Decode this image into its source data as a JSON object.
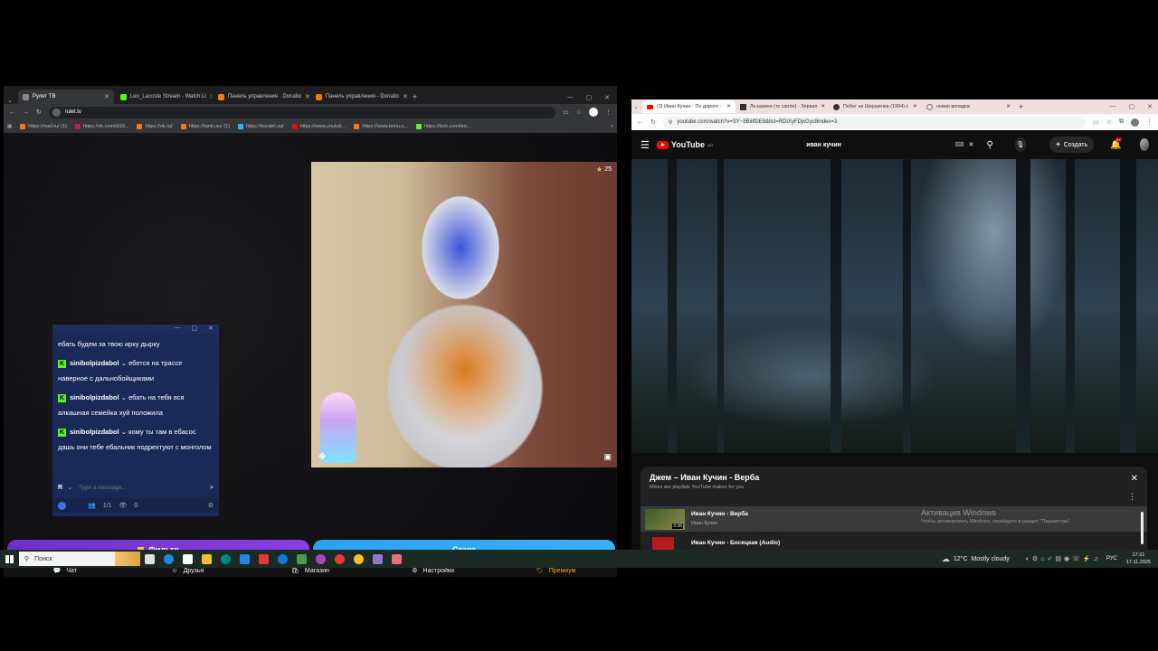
{
  "left_browser": {
    "tabs": [
      {
        "title": "Рулет ТВ",
        "active": true,
        "color": "#888888"
      },
      {
        "title": "Leo_Lacoste Stream - Watch Li",
        "color": "#53fc18"
      },
      {
        "title": "Панель управления - Donatio",
        "color": "#f57c00"
      },
      {
        "title": "Панель управления - Donatio",
        "color": "#f57c00"
      }
    ],
    "url": "rulet.tv",
    "bookmarks": [
      {
        "label": "https://mail.ru/ (1)",
        "color": "#f57c00"
      },
      {
        "label": "https://vk.com/id19...",
        "color": "#c2185b"
      },
      {
        "label": "https://ok.ru/",
        "color": "#f57c00"
      },
      {
        "label": "https://tanki.su/ (1)",
        "color": "#f57c00"
      },
      {
        "label": "https://korabli.su/",
        "color": "#29b6f6"
      },
      {
        "label": "https://www.youtub...",
        "color": "#f00000"
      },
      {
        "label": "https://www.temu.c...",
        "color": "#f57c00"
      },
      {
        "label": "https://kick.com/leo...",
        "color": "#53fc18"
      }
    ]
  },
  "chat": {
    "first_line": "ебать будем за твою ирку дырку",
    "messages": [
      {
        "user": "sinibolpizdabol",
        "text": "ебется на трассе наверное с дальнобойщиками"
      },
      {
        "user": "sinibolpizdabol",
        "text": "ебать на тебя вся алкашная семейка хуй положила"
      },
      {
        "user": "sinibolpizdabol",
        "text": "кому ты там в ебасос дашь они тебе ебальник подрехтуют с монголом"
      }
    ],
    "input_letter": "R",
    "placeholder": "Type a message...",
    "users_count": "1/1",
    "viewers": "0"
  },
  "webcam": {
    "stars": "25"
  },
  "buttons": {
    "filter": "Фильтр",
    "start": "Старт"
  },
  "bottom_nav": [
    {
      "label": "Чат",
      "icon": "chat-icon"
    },
    {
      "label": "Друзья",
      "icon": "friends-icon"
    },
    {
      "label": "Магазин",
      "icon": "shop-icon"
    },
    {
      "label": "Настройки",
      "icon": "gear-icon"
    },
    {
      "label": "Премиум",
      "icon": "premium-icon"
    }
  ],
  "right_browser": {
    "tabs": [
      {
        "title": "(3) Иван Кучин - По дороге -",
        "active": true,
        "color": "#f00000"
      },
      {
        "title": "Лк казино (тк сапло) - Зеркал",
        "color": "#333333"
      },
      {
        "title": "Побег из Шоушенка (1994) с",
        "color": "#333333"
      },
      {
        "title": "новая вкладка",
        "color": "#777777"
      }
    ],
    "url": "youtube.com/watch?v=SY~5BiilfDE8&list=RDiXyFDjxGyc8index=3",
    "youtube": {
      "logo": "YouTube",
      "region": "MD",
      "search_query": "иван кучин",
      "create_label": "Создать",
      "notifications": "9+"
    },
    "playlist": {
      "title": "Джем – Иван Кучин - Верба",
      "subtitle": "Mixes are playlists YouTube makes for you",
      "items": [
        {
          "title": "Иван Кучин - Верба",
          "channel": "Иван Кучин",
          "duration": "3:36"
        },
        {
          "title": "Иван Кучин - Босяцкая (Audio)",
          "channel": "",
          "duration": ""
        }
      ],
      "activation_title": "Активация Windows",
      "activation_text": "Чтобы активировать Windows, перейдите в раздел \"Параметры\"."
    }
  },
  "taskbar": {
    "search_placeholder": "Поиск",
    "weather": "12°C  Mostly cloudy",
    "language": "РУС",
    "time": "17:21",
    "date": "17.11.2025",
    "app_colors": [
      "#e0e0e0",
      "#1e88e5",
      "#ffffff",
      "#fbc02d",
      "#00897b",
      "#1e88e5",
      "#e53935",
      "#0b7ad1",
      "#43a047",
      "#ab47bc",
      "#e53935",
      "#fbc02d",
      "#9575cd",
      "#e57373"
    ]
  }
}
